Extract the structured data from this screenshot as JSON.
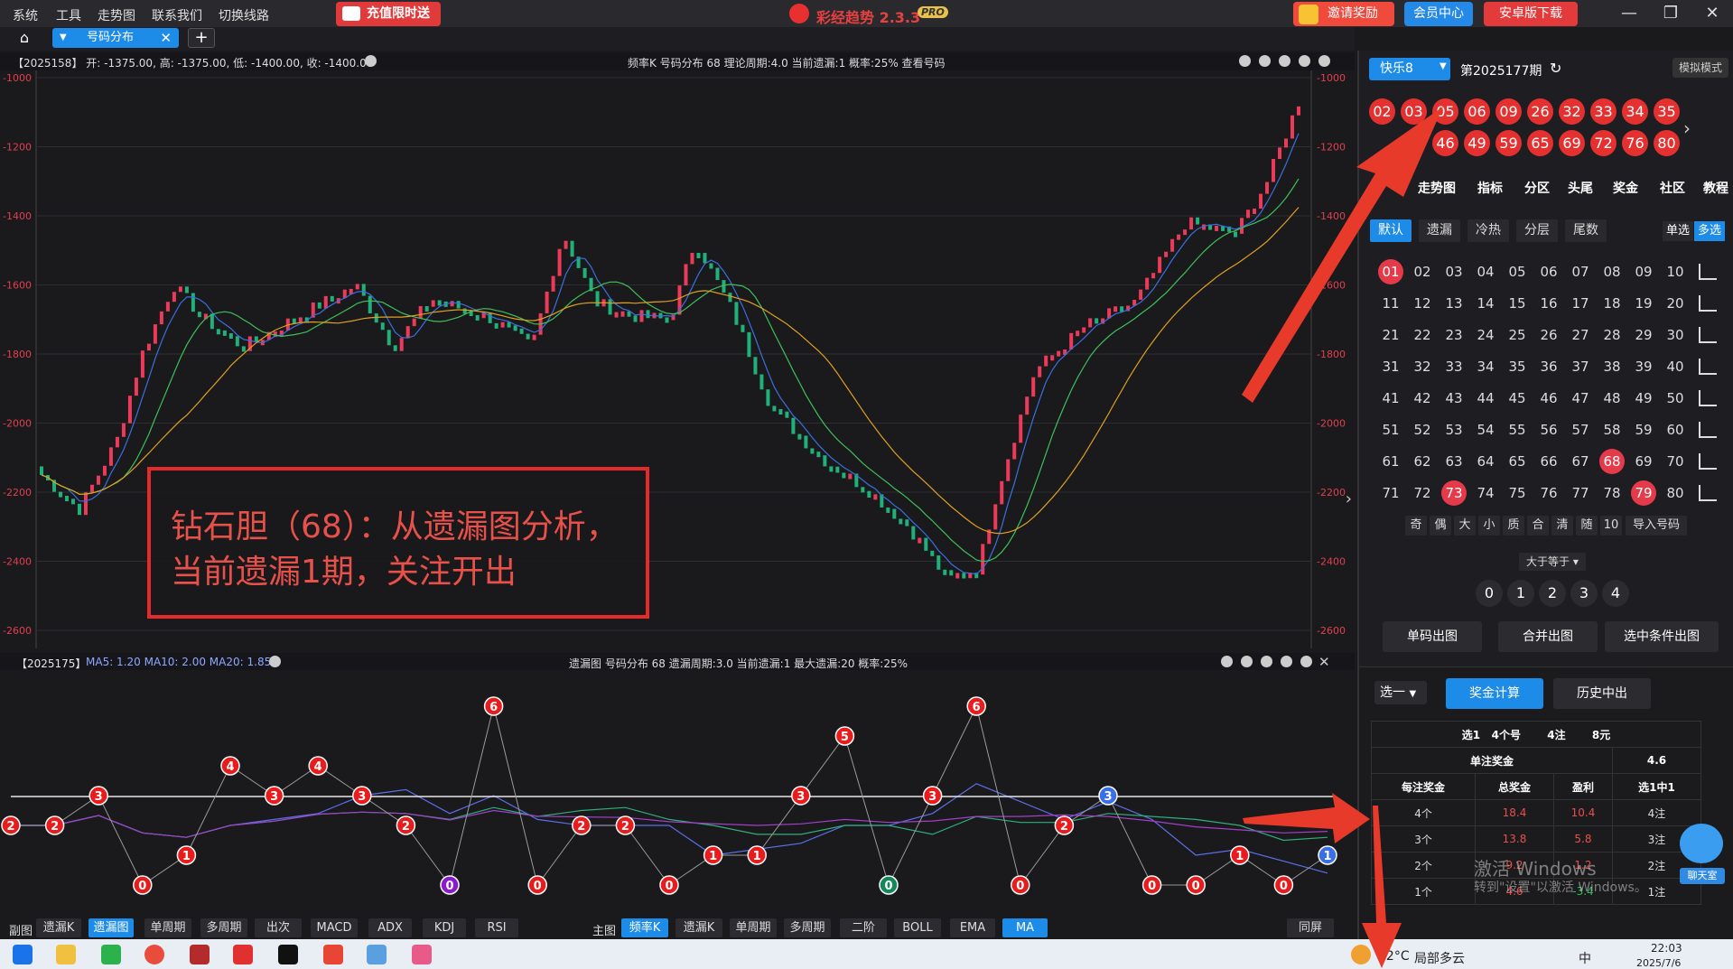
{
  "menu": {
    "items": [
      "系统",
      "工具",
      "走势图",
      "联系我们",
      "切换线路"
    ],
    "promo": "充值限时送",
    "app_title": "彩经趋势 2.3.3",
    "pro_badge": "PRO",
    "invite": "邀请奖励",
    "member": "会员中心",
    "android": "安卓版下载",
    "window_controls": {
      "minimize": "—",
      "restore": "❐",
      "close": "✕"
    }
  },
  "tabs": {
    "home_icon": "⌂",
    "active_tab": "号码分布",
    "caret": "▼",
    "close": "✕",
    "add": "+"
  },
  "main_chart": {
    "info_ohlc": "【2025158】 开: -1375.00, 高: -1375.00, 低: -1400.00, 收: -1400.00",
    "info_stats": "频率K   号码分布   68      理论周期:4.0    当前遗漏:1    概率:25%        查看号码",
    "y_ticks": [
      "-1000",
      "-1200",
      "-1400",
      "-1600",
      "-1800",
      "-2000",
      "-2200",
      "-2400",
      "-2600"
    ],
    "colors": {
      "up": "#ec3b5a",
      "down": "#22b07a",
      "ma5": "#3a6fe0",
      "ma10": "#3fbf5a",
      "ma20": "#e0a020",
      "axis": "#e04050"
    }
  },
  "annotation": {
    "text": "钻石胆（68）：从遗漏图分析，当前遗漏1期，关注开出"
  },
  "sub_chart": {
    "info_period": "【2025175】",
    "info_ma": "MA5: 1.20   MA10: 2.00   MA20: 1.85",
    "info_stats": "遗漏图   号码分布   68      遗漏周期:3.0    当前遗漏:1    最大遗漏:20    概率:25%"
  },
  "chart_data": {
    "type": "line",
    "title": "遗漏图",
    "xlabel": "",
    "ylabel": "",
    "series": [
      {
        "name": "遗漏",
        "values": [
          2,
          2,
          3,
          0,
          1,
          4,
          3,
          4,
          3,
          2,
          0,
          6,
          0,
          2,
          2,
          0,
          1,
          1,
          3,
          5,
          0,
          3,
          6,
          0,
          2,
          3,
          0,
          0,
          1,
          0,
          1
        ]
      }
    ],
    "threshold": 3,
    "ylim": [
      0,
      6
    ]
  },
  "bottom_bar": {
    "left_label": "副图",
    "left_buttons": [
      "遗漏K",
      "遗漏图",
      "单周期",
      "多周期",
      "出次",
      "MACD",
      "ADX",
      "KDJ",
      "RSI"
    ],
    "left_active": "遗漏图",
    "right_label": "主图",
    "right_buttons": [
      "频率K",
      "遗漏K",
      "单周期",
      "多周期",
      "二阶",
      "BOLL",
      "EMA",
      "MA"
    ],
    "right_active": [
      "频率K",
      "MA"
    ],
    "fullscreen": "同屏"
  },
  "right_panel": {
    "lottery": "快乐8",
    "period": "第2025177期",
    "simulate": "模拟模式",
    "draw_row1": [
      "02",
      "03",
      "05",
      "06",
      "09",
      "26",
      "32",
      "33",
      "34",
      "35"
    ],
    "draw_row2": [
      "46",
      "49",
      "59",
      "65",
      "69",
      "72",
      "76",
      "80"
    ],
    "categories": [
      "走势图",
      "指标",
      "分区",
      "头尾",
      "奖金",
      "社区",
      "教程"
    ],
    "sub_tabs": [
      "默认",
      "遗漏",
      "冷热",
      "分层",
      "尾数"
    ],
    "mode_single": "单选",
    "mode_multi": "多选",
    "selected_numbers": [
      "01",
      "68",
      "73",
      "79"
    ],
    "filters": [
      "奇",
      "偶",
      "大",
      "小",
      "质",
      "合",
      "清",
      "随",
      "10",
      "导入号码"
    ],
    "condition": "大于等于 ▾",
    "counts": [
      "0",
      "1",
      "2",
      "3",
      "4"
    ],
    "actions": [
      "单码出图",
      "合并出图",
      "选中条件出图"
    ]
  },
  "calc": {
    "select": "选一",
    "calc_btn": "奖金计算",
    "history_btn": "历史中出",
    "summary": [
      "选1",
      "4个号",
      "4注",
      "8元"
    ],
    "single_prize_label": "单注奖金",
    "single_prize_value": "4.6",
    "headers": [
      "每注奖金",
      "总奖金",
      "盈利",
      "选1中1"
    ],
    "rows": [
      [
        "4个",
        "18.4",
        "10.4",
        "4注"
      ],
      [
        "3个",
        "13.8",
        "5.8",
        "3注"
      ],
      [
        "2个",
        "9.2",
        "1.2",
        "2注"
      ],
      [
        "1个",
        "4.6",
        "-3.4",
        "1注"
      ]
    ],
    "activate1": "激活 Windows",
    "activate2": "转到\"设置\"以激活 Windows。",
    "chat": "聊天室"
  },
  "taskbar": {
    "temp": "32°C",
    "weather": "局部多云",
    "ime": "中",
    "time": "22:03",
    "date": "2025/7/6"
  }
}
